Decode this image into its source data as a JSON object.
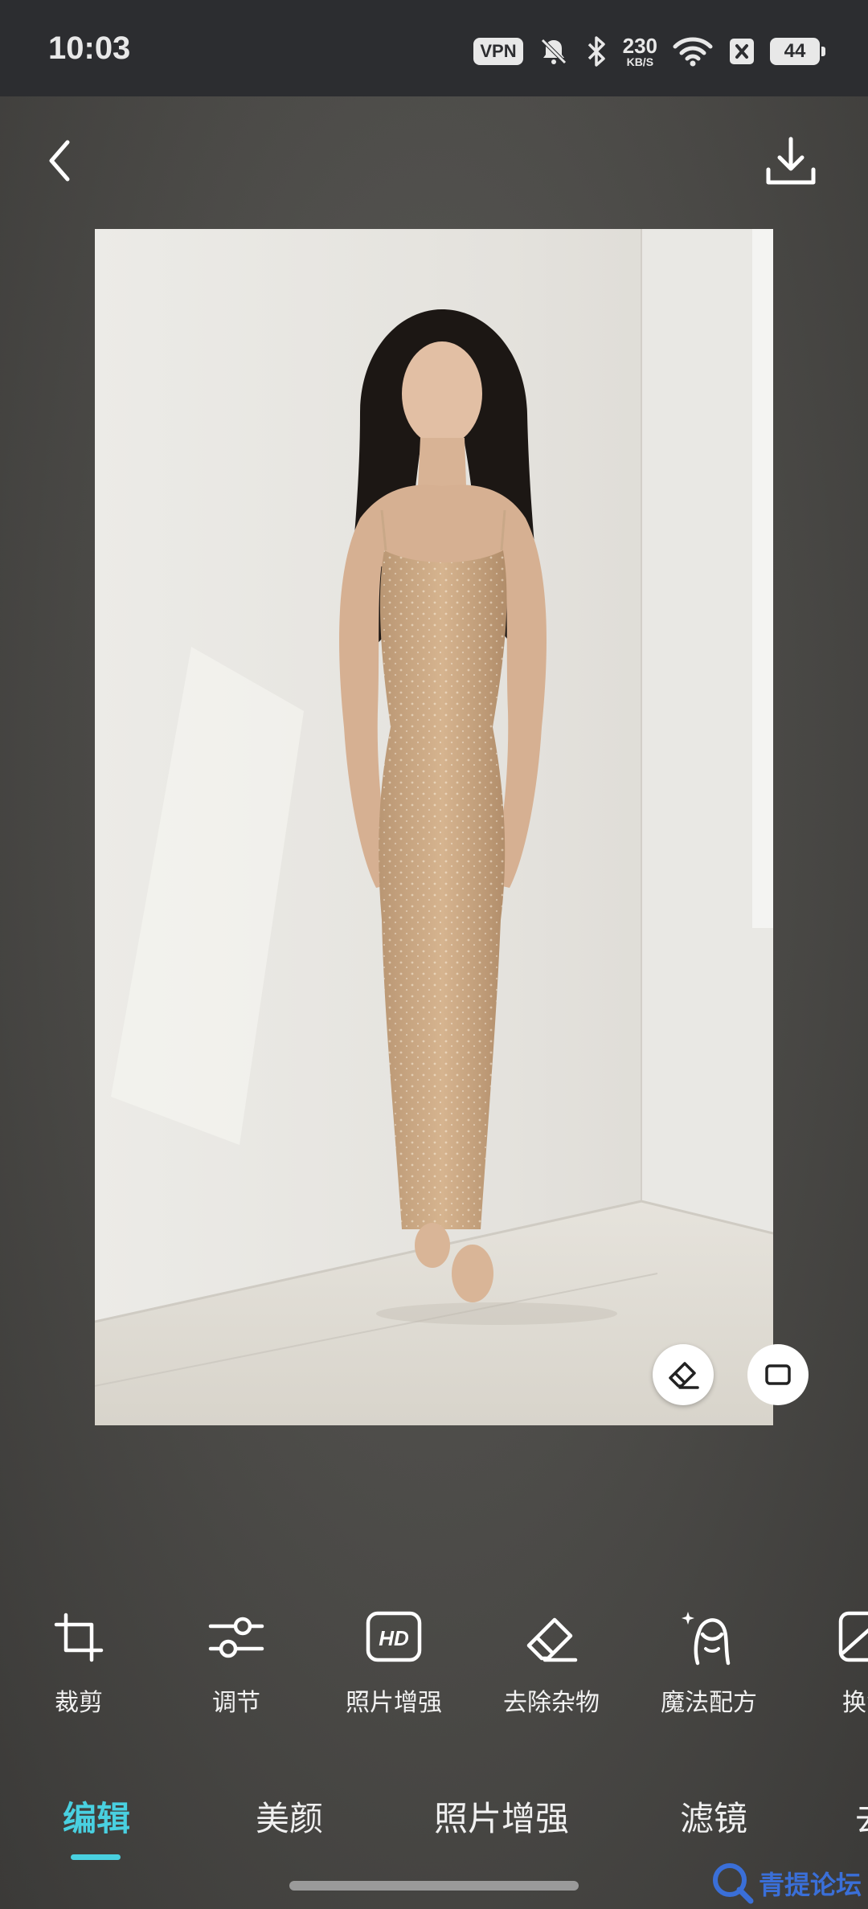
{
  "status_bar": {
    "time": "10:03",
    "vpn": "VPN",
    "net_speed_value": "230",
    "net_speed_unit": "KB/S",
    "battery": "44"
  },
  "tools": [
    {
      "label": "裁剪",
      "icon": "crop-icon"
    },
    {
      "label": "调节",
      "icon": "sliders-icon"
    },
    {
      "label": "照片增强",
      "icon": "hd-icon"
    },
    {
      "label": "去除杂物",
      "icon": "eraser-icon"
    },
    {
      "label": "魔法配方",
      "icon": "magic-portrait-icon"
    },
    {
      "label": "换背",
      "icon": "background-icon"
    }
  ],
  "tabs": [
    {
      "label": "编辑",
      "active": true
    },
    {
      "label": "美颜",
      "active": false
    },
    {
      "label": "照片增强",
      "active": false
    },
    {
      "label": "滤镜",
      "active": false
    },
    {
      "label": "去",
      "active": false
    }
  ],
  "colors": {
    "accent": "#49d0e0",
    "status_bar_bg": "#2c2d30",
    "page_bg": "#4a4946",
    "watermark_blue": "#3a6fd8"
  },
  "watermark": "青提论坛"
}
